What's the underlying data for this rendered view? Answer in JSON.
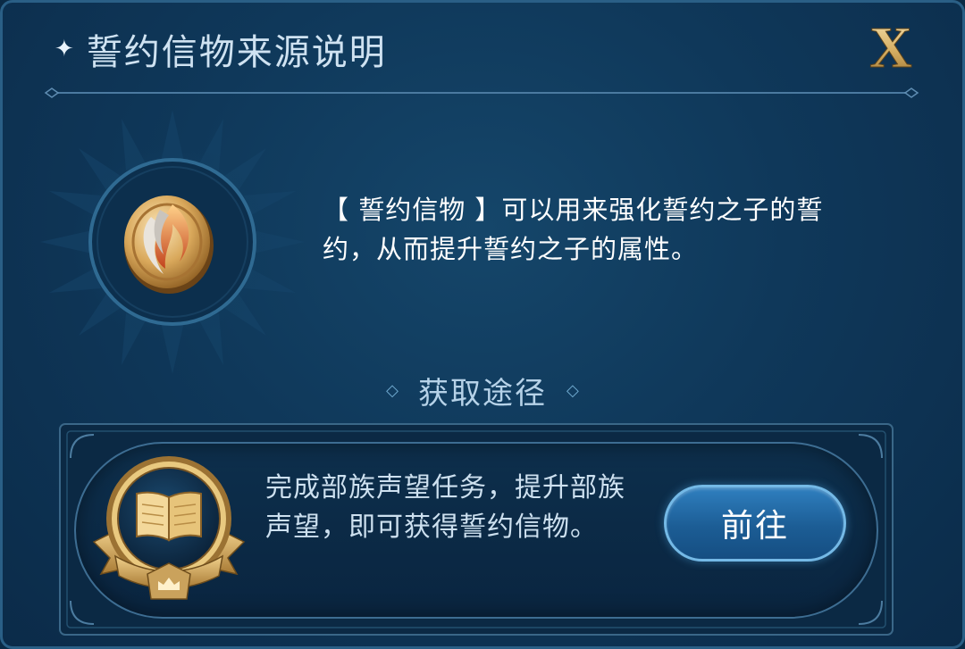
{
  "dialog": {
    "title": "誓约信物来源说明",
    "title_icon": "sparkle-star-icon",
    "close_label": "X"
  },
  "item": {
    "icon": "flame-coin-icon",
    "description": "【 誓约信物 】可以用来强化誓约之子的誓约，从而提升誓约之子的属性。"
  },
  "obtain": {
    "section_title": "获取途径",
    "sources": [
      {
        "icon": "open-book-badge-icon",
        "text": "完成部族声望任务，提升部族声望，即可获得誓约信物。",
        "button_label": "前往"
      }
    ]
  },
  "colors": {
    "background": "#0f385a",
    "accent_gold": "#d9b56a",
    "button_blue": "#1c5d95",
    "button_border": "#74b9e6",
    "text_light": "#cde0ef"
  }
}
